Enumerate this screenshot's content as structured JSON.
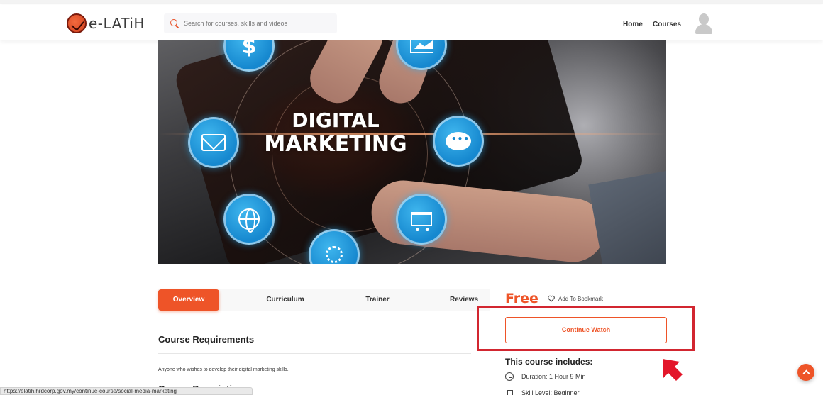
{
  "header": {
    "logo_text": "e-LATiH",
    "search": {
      "placeholder": "Search for courses, skills and videos"
    },
    "nav": {
      "home": "Home",
      "courses": "Courses"
    }
  },
  "hero": {
    "title_line1": "DIGITAL",
    "title_line2": "MARKETING",
    "icons": [
      "dollar-icon",
      "chart-icon",
      "mail-icon",
      "chat-icon",
      "globe-icon",
      "cart-icon",
      "gear-icon"
    ]
  },
  "tabs": [
    {
      "label": "Overview",
      "active": true
    },
    {
      "label": "Curriculum",
      "active": false
    },
    {
      "label": "Trainer",
      "active": false
    },
    {
      "label": "Reviews",
      "active": false
    }
  ],
  "overview": {
    "requirements_title": "Course Requirements",
    "requirements_text": "Anyone who wishes to develop their digital marketing skills.",
    "description_title_partial": "Course Description"
  },
  "sidebar": {
    "price": "Free",
    "bookmark_label": "Add To Bookmark",
    "continue_label": "Continue Watch",
    "includes_title": "This course includes:",
    "duration": "Duration: 1 Hour 9 Min",
    "skill_level": "Skill Level: Beginner"
  },
  "status_bar": {
    "url": "https://elatih.hrdcorp.gov.my/continue-course/social-media-marketing"
  },
  "colors": {
    "accent": "#ee5428",
    "highlight": "#d22630"
  }
}
